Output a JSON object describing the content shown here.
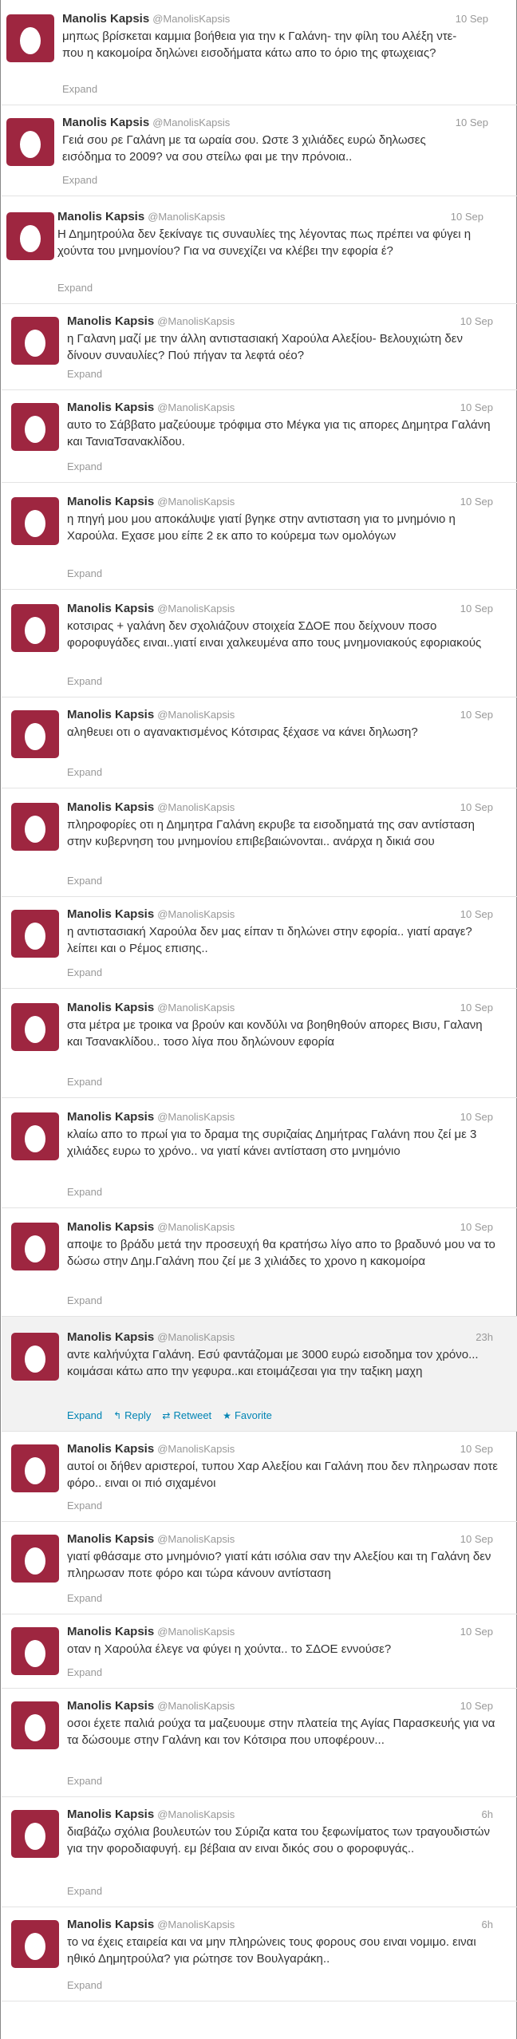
{
  "account": {
    "name": "Manolis Kapsis",
    "handle": "@ManolisKapsis"
  },
  "colors": {
    "avatar_bg": "#9e2640",
    "link": "#0084b4",
    "muted": "#999999",
    "highlight_bg": "#f2f2f2"
  },
  "icons": {
    "avatar": "default-egg-avatar",
    "reply": "reply-icon",
    "retweet": "retweet-icon",
    "favorite": "star-icon"
  },
  "tweets": [
    {
      "time": "10 Sep",
      "text": "μηπως βρίσκεται καμμια βοήθεια για την κ Γαλάνη- την φίλη του Αλέξη ντε- που η κακομοίρα δηλώνει εισοδήματα κάτω απο το όριο της φτωχειας?",
      "expand": "Expand"
    },
    {
      "time": "10 Sep",
      "text": "Γειά σου ρε Γαλάνη με τα ωραία σου. Ωστε 3 χιλιάδες ευρώ δηλωσες εισόδημα το 2009? να σου στείλω φαι με την πρόνοια..",
      "expand": "Expand"
    },
    {
      "time": "10 Sep",
      "text": "Η Δημητρούλα δεν ξεκίναγε τις συναυλίες της λέγοντας πως πρέπει να φύγει η χούντα του μνημονίου? Για να συνεχίζει να κλέβει την εφορία έ?",
      "expand": "Expand"
    },
    {
      "time": "10 Sep",
      "text": "η Γαλανη μαζί με την άλλη αντιστασιακή Χαρούλα Αλεξίου- Βελουχιώτη δεν δίνουν συναυλίες? Πού πήγαν τα λεφτά οέο?",
      "expand": "Expand"
    },
    {
      "time": "10 Sep",
      "text": "αυτο το Σάββατο μαζεύουμε τρόφιμα στο Μέγκα για τις απορες Δημητρα Γαλάνη και ΤανιαΤσανακλίδου.",
      "expand": "Expand"
    },
    {
      "time": "10 Sep",
      "text": "η πηγή μου μου αποκάλυψε γιατί βγηκε στην αντισταση για το μνημόνιο η Χαρούλα. Εχασε μου είπε 2 εκ απο το κούρεμα των ομολόγων",
      "expand": "Expand"
    },
    {
      "time": "10 Sep",
      "text": "κοτσιρας + γαλάνη δεν σχολιάζουν στοιχεία ΣΔΟΕ που δείχνουν ποσο φοροφυγάδες ειναι..γιατί ειναι χαλκευμένα απο τους μνημονιακούς εφοριακούς",
      "expand": "Expand"
    },
    {
      "time": "10 Sep",
      "text": "αληθευει οτι ο αγανακτισμένος Κότσιρας ξέχασε να κάνει δηλωση?",
      "expand": "Expand"
    },
    {
      "time": "10 Sep",
      "text": "πληροφορίες οτι η Δημητρα Γαλάνη εκρυβε τα εισοδηματά της σαν αντίσταση στην κυβερνηση του μνημονίου επιβεβαιώνονται.. ανάρχα η δικιά σου",
      "expand": "Expand"
    },
    {
      "time": "10 Sep",
      "text": "η αντιστασιακή Χαρούλα δεν μας είπαν τι δηλώνει στην εφορία.. γιατί αραγε? λείπει και ο Ρέμος επισης..",
      "expand": "Expand"
    },
    {
      "time": "10 Sep",
      "text": "στα μέτρα με τροικα να βρούν και κονδύλι να βοηθηθούν απορες Βισυ, Γαλανη και Τσανακλίδου.. τοσο λίγα που δηλώνουν εφορία",
      "expand": "Expand"
    },
    {
      "time": "10 Sep",
      "text": "κλαίω απο το πρωί για το δραμα της συριζαίας Δημήτρας Γαλάνη που ζεί με 3 χιλιάδες ευρω το χρόνο.. να γιατί κάνει αντίσταση στο μνημόνιο",
      "expand": "Expand"
    },
    {
      "time": "10 Sep",
      "text": "αποψε το βράδυ μετά την προσευχή θα κρατήσω λίγο απο το βραδυνό μου να το δώσω στην Δημ.Γαλάνη που ζεί με 3 χιλιάδες το χρονο η κακομοίρα",
      "expand": "Expand"
    },
    {
      "time": "23h",
      "text": "αντε καλήνύχτα Γαλάνη. Εσύ φαντάζομαι με 3000 ευρώ εισοδημα τον χρόνο... κοιμάσαι κάτω απο την γεφυρα..και ετοιμάζεσαι για την ταξικη μαχη",
      "expand": "Expand",
      "reply": "Reply",
      "retweet": "Retweet",
      "favorite": "Favorite"
    },
    {
      "time": "10 Sep",
      "text": "αυτοί οι δήθεν αριστεροί, τυπου Χαρ Αλεξίου και Γαλάνη που δεν πληρωσαν ποτε φόρο.. ειναι οι πιό σιχαμένοι",
      "expand": "Expand"
    },
    {
      "time": "10 Sep",
      "text": "γιατί φθάσαμε στο μνημόνιο? γιατί κάτι ισόλια σαν την Αλεξίου και τη Γαλάνη δεν πληρωσαν ποτε φόρο και τώρα κάνουν αντίσταση",
      "expand": "Expand"
    },
    {
      "time": "10 Sep",
      "text": "οταν η Χαρούλα έλεγε να φύγει η χούντα.. το ΣΔΟΕ εννούσε?",
      "expand": "Expand"
    },
    {
      "time": "10 Sep",
      "text": "οσοι έχετε παλιά ρούχα τα μαζευουμε στην πλατεία της Αγίας Παρασκευής για να τα δώσουμε στην Γαλάνη και τον Κότσιρα που υποφέρουν...",
      "expand": "Expand"
    },
    {
      "time": "6h",
      "text": "διαβάζω σχόλια βουλευτών του Σύριζα κατα του ξεφωνίματος των τραγουδιστών για την φοροδιαφυγή. εμ βέβαια αν ειναι δικός σου ο φοροφυγάς..",
      "expand": "Expand"
    },
    {
      "time": "6h",
      "text": "το να έχεις εταιρεία και να μην πληρώνεις τους φορους σου ειναι νομιμο. ειναι ηθικό Δημητρούλα? για ρώτησε τον Βουλγαράκη..",
      "expand": "Expand"
    }
  ]
}
